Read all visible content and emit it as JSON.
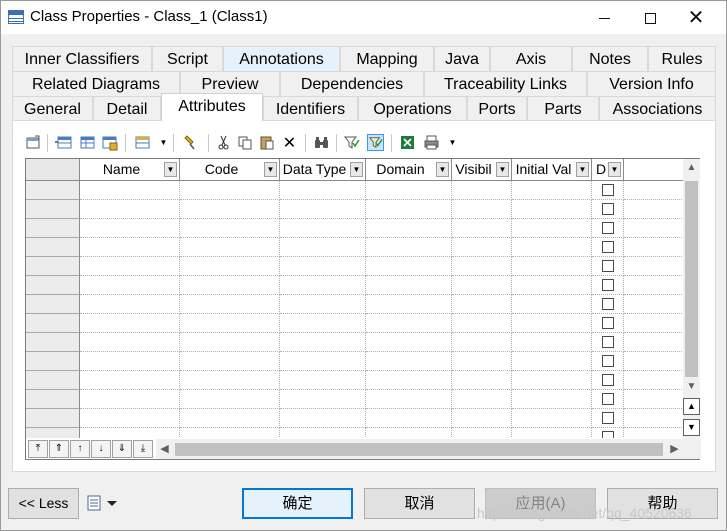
{
  "window": {
    "title": "Class Properties - Class_1 (Class1)",
    "close_glyph": "✕"
  },
  "tabs": {
    "row1": [
      "Inner Classifiers",
      "Script",
      "Annotations",
      "Mapping",
      "Java",
      "Axis",
      "Notes",
      "Rules"
    ],
    "row2": [
      "Related Diagrams",
      "Preview",
      "Dependencies",
      "Traceability Links",
      "Version Info"
    ],
    "row3": [
      "General",
      "Detail",
      "Attributes",
      "Identifiers",
      "Operations",
      "Ports",
      "Parts",
      "Associations"
    ],
    "active": "Attributes",
    "highlighted": "Annotations"
  },
  "toolbar": {
    "icons": [
      "properties-icon",
      "add-row-icon",
      "insert-row-icon",
      "add-attributes-icon",
      "column-chooser-icon",
      "find-rule-icon",
      "cut-icon",
      "copy-icon",
      "paste-icon",
      "delete-icon",
      "find-icon",
      "filter-icon",
      "customize-columns-icon",
      "excel-export-icon",
      "print-icon"
    ]
  },
  "grid": {
    "columns": [
      "Name",
      "Code",
      "Data Type",
      "Domain",
      "Visibil",
      "Initial Val",
      "D"
    ],
    "row_count": 14,
    "checkbox_column": "D"
  },
  "nav_buttons": {
    "icons": [
      "move-top-icon",
      "move-up-page-icon",
      "move-up-icon",
      "move-down-icon",
      "move-down-page-icon",
      "move-bottom-icon"
    ]
  },
  "buttons": {
    "less": "<< Less",
    "ok": "确定",
    "cancel": "取消",
    "apply": "应用(A)",
    "help": "帮助"
  },
  "watermark": "https://blog.csdn.net/qq_40520636",
  "colors": {
    "accent": "#0078d7",
    "tab_highlight": "#e5f1fb",
    "disabled_text": "#838383"
  }
}
